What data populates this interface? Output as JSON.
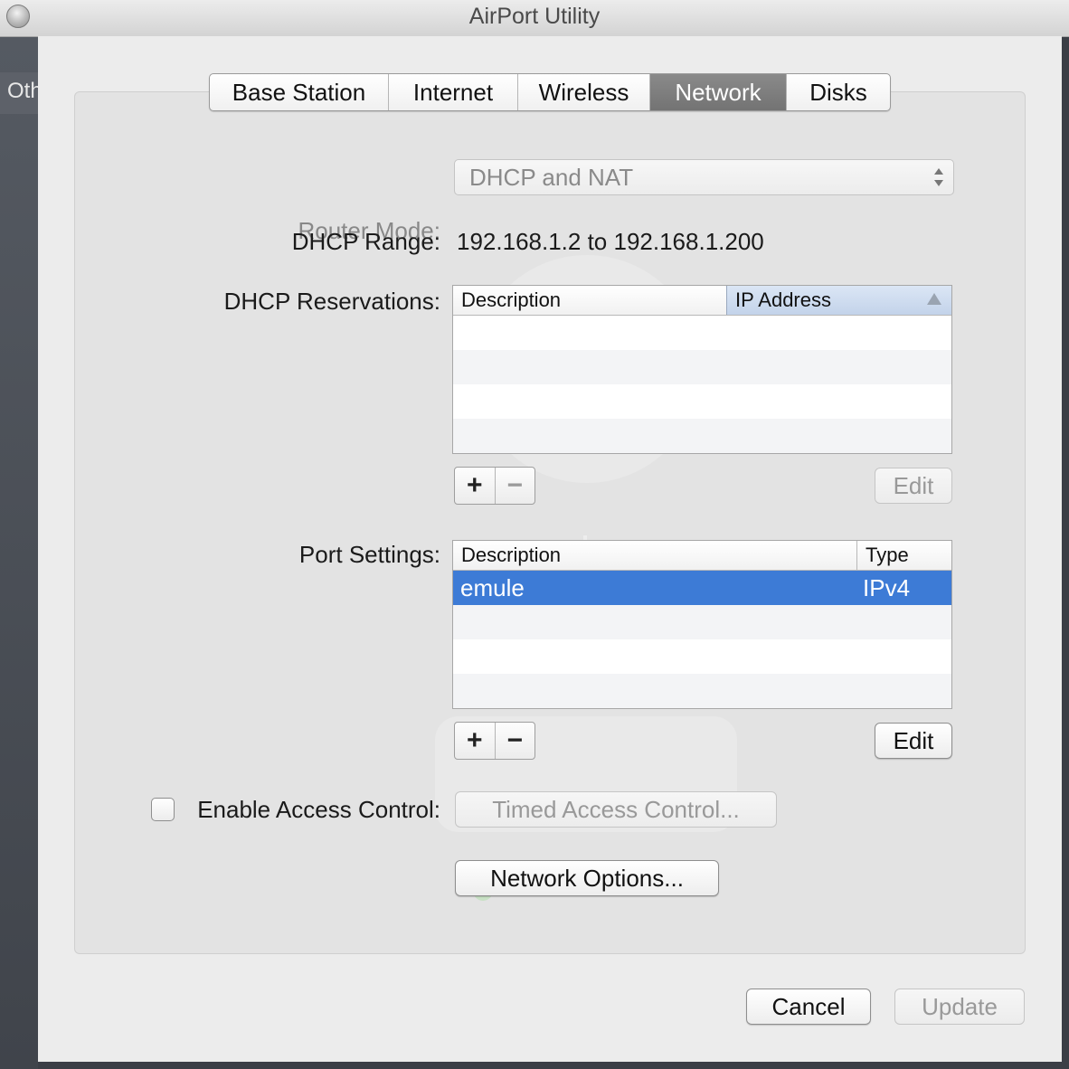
{
  "window": {
    "title": "AirPort Utility"
  },
  "background": {
    "sidebar_text": "Oth"
  },
  "tabs": [
    {
      "label": "Base Station",
      "selected": false
    },
    {
      "label": "Internet",
      "selected": false
    },
    {
      "label": "Wireless",
      "selected": false
    },
    {
      "label": "Network",
      "selected": true
    },
    {
      "label": "Disks",
      "selected": false
    }
  ],
  "router_mode": {
    "label": "Router Mode:",
    "value": "DHCP and NAT"
  },
  "dhcp_range": {
    "label": "DHCP Range:",
    "value": "192.168.1.2 to 192.168.1.200"
  },
  "dhcp_reservations": {
    "label": "DHCP Reservations:",
    "columns": [
      "Description",
      "IP Address"
    ],
    "rows": [],
    "edit_label": "Edit"
  },
  "port_settings": {
    "label": "Port Settings:",
    "columns": [
      "Description",
      "Type"
    ],
    "rows": [
      {
        "description": "emule",
        "type": "IPv4",
        "selected": true
      }
    ],
    "edit_label": "Edit"
  },
  "controls": {
    "add": "+",
    "remove": "−"
  },
  "access_control": {
    "label": "Enable Access Control:",
    "checked": false,
    "timed_label": "Timed Access Control..."
  },
  "network_options": {
    "label": "Network Options..."
  },
  "footer": {
    "cancel": "Cancel",
    "update": "Update"
  },
  "colors": {
    "selection": "#3d7bd6",
    "selected_tab": "#7d7d7d"
  }
}
